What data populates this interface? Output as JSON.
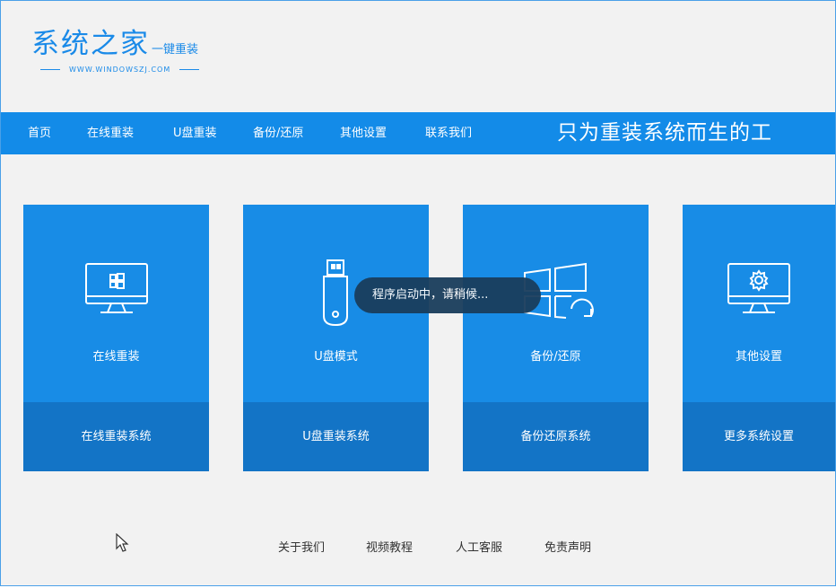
{
  "logo": {
    "main": "系统之家",
    "sub": "一键重装",
    "url": "WWW.WINDOWSZJ.COM"
  },
  "nav": {
    "items": [
      "首页",
      "在线重装",
      "U盘重装",
      "备份/还原",
      "其他设置",
      "联系我们"
    ],
    "slogan": "只为重装系统而生的工"
  },
  "cards": [
    {
      "title": "在线重装",
      "bottom": "在线重装系统",
      "icon": "monitor-windows-icon"
    },
    {
      "title": "U盘模式",
      "bottom": "U盘重装系统",
      "icon": "usb-drive-icon"
    },
    {
      "title": "备份/还原",
      "bottom": "备份还原系统",
      "icon": "windows-restore-icon"
    },
    {
      "title": "其他设置",
      "bottom": "更多系统设置",
      "icon": "monitor-gear-icon"
    }
  ],
  "toast": "程序启动中，请稍候...",
  "footer": {
    "links": [
      "关于我们",
      "视频教程",
      "人工客服",
      "免责声明"
    ]
  },
  "colors": {
    "brand": "#138be8",
    "card": "#188ce6",
    "card_bottom": "#1374c6",
    "toast": "#1a3d5c"
  }
}
